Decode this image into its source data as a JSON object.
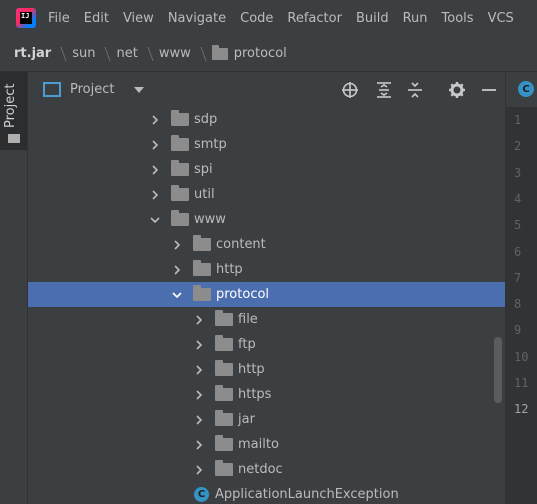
{
  "menu": {
    "items": [
      "File",
      "Edit",
      "View",
      "Navigate",
      "Code",
      "Refactor",
      "Build",
      "Run",
      "Tools",
      "VCS"
    ]
  },
  "breadcrumb": [
    "rt.jar",
    "sun",
    "net",
    "www",
    "protocol"
  ],
  "strip": {
    "label": "Project"
  },
  "panel": {
    "title": "Project"
  },
  "tree": {
    "rows": [
      {
        "label": "sdp",
        "type": "folder",
        "depth": 1,
        "expanded": false
      },
      {
        "label": "smtp",
        "type": "folder",
        "depth": 1,
        "expanded": false
      },
      {
        "label": "spi",
        "type": "folder",
        "depth": 1,
        "expanded": false
      },
      {
        "label": "util",
        "type": "folder",
        "depth": 1,
        "expanded": false
      },
      {
        "label": "www",
        "type": "folder",
        "depth": 1,
        "expanded": true
      },
      {
        "label": "content",
        "type": "folder",
        "depth": 2,
        "expanded": false
      },
      {
        "label": "http",
        "type": "folder",
        "depth": 2,
        "expanded": false
      },
      {
        "label": "protocol",
        "type": "folder",
        "depth": 2,
        "expanded": true,
        "selected": true
      },
      {
        "label": "file",
        "type": "folder",
        "depth": 3,
        "expanded": false
      },
      {
        "label": "ftp",
        "type": "folder",
        "depth": 3,
        "expanded": false
      },
      {
        "label": "http",
        "type": "folder",
        "depth": 3,
        "expanded": false
      },
      {
        "label": "https",
        "type": "folder",
        "depth": 3,
        "expanded": false
      },
      {
        "label": "jar",
        "type": "folder",
        "depth": 3,
        "expanded": false
      },
      {
        "label": "mailto",
        "type": "folder",
        "depth": 3,
        "expanded": false
      },
      {
        "label": "netdoc",
        "type": "folder",
        "depth": 3,
        "expanded": false
      },
      {
        "label": "ApplicationLaunchException",
        "type": "class",
        "depth": 3
      }
    ]
  },
  "editor": {
    "tab_icon": "C",
    "line_numbers": [
      "1",
      "2",
      "3",
      "4",
      "5",
      "6",
      "7",
      "8",
      "9",
      "10",
      "11",
      "12"
    ],
    "current_line": "12"
  },
  "colors": {
    "background": "#3c3f41",
    "selection": "#4b6eaf",
    "accent": "#4b9cd3",
    "class_icon": "#3592c4",
    "folder": "#8c8c8c"
  }
}
